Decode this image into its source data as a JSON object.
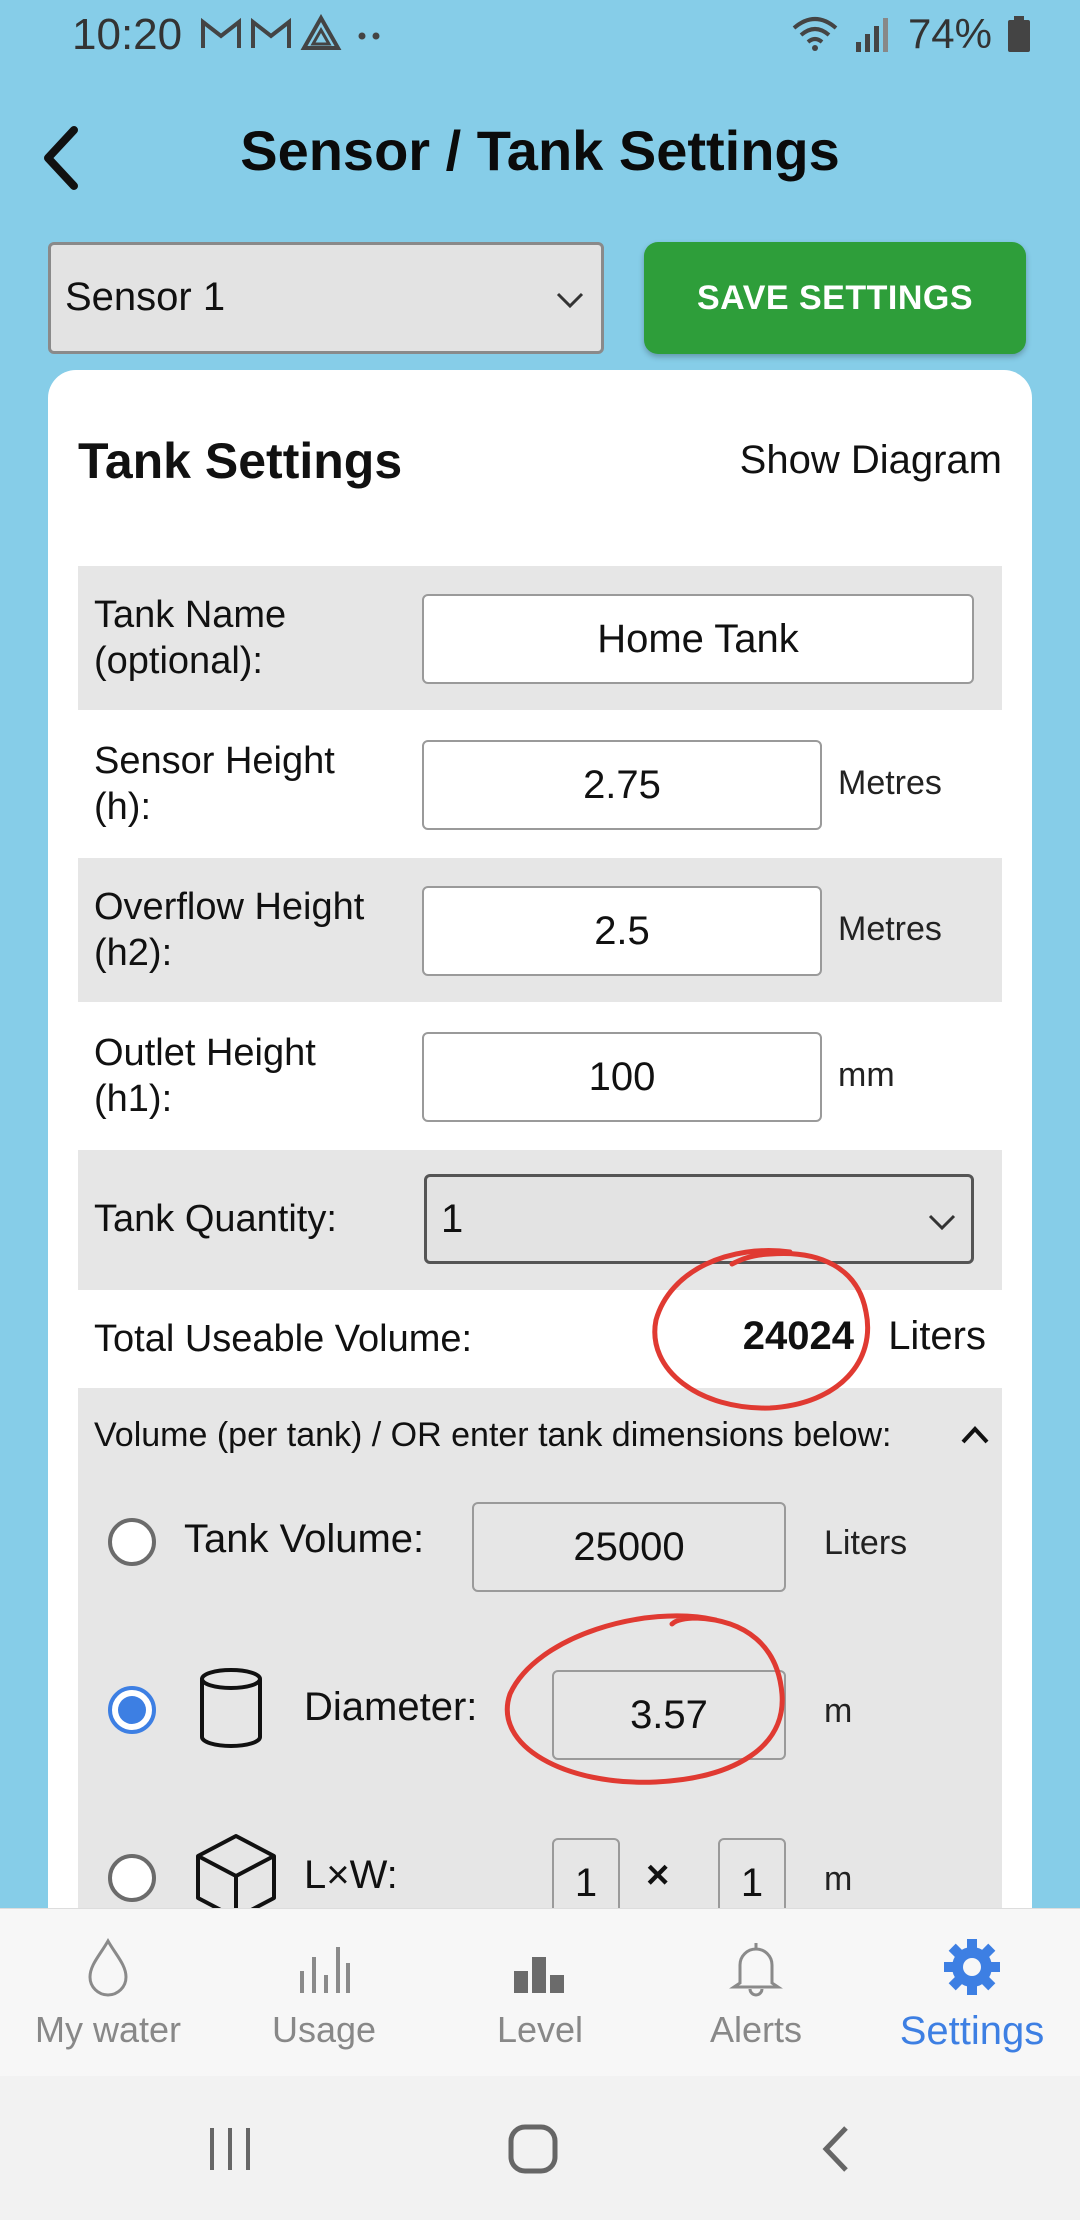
{
  "status_bar": {
    "time": "10:20",
    "battery": "74%"
  },
  "header": {
    "title": "Sensor / Tank Settings"
  },
  "sensor_select": {
    "value": "Sensor 1"
  },
  "save_button": {
    "label": "SAVE SETTINGS"
  },
  "card": {
    "title": "Tank Settings",
    "show_diagram": "Show Diagram",
    "tank_name": {
      "label": "Tank Name (optional):",
      "value": "Home Tank"
    },
    "sensor_height": {
      "label": "Sensor Height (h):",
      "value": "2.75",
      "unit": "Metres"
    },
    "overflow_height": {
      "label": "Overflow Height (h2):",
      "value": "2.5",
      "unit": "Metres"
    },
    "outlet_height": {
      "label": "Outlet Height (h1):",
      "value": "100",
      "unit": "mm"
    },
    "tank_quantity": {
      "label": "Tank Quantity:",
      "value": "1"
    },
    "total_volume": {
      "label": "Total Useable Volume:",
      "value": "24024",
      "unit": "Liters"
    },
    "volume_section": {
      "header": "Volume (per tank) / OR enter tank dimensions below:",
      "tank_volume": {
        "label": "Tank Volume:",
        "value": "25000",
        "unit": "Liters",
        "selected": false
      },
      "diameter": {
        "label": "Diameter:",
        "value": "3.57",
        "unit": "m",
        "selected": true
      },
      "lxw": {
        "label": "L×W:",
        "length": "1",
        "times": "×",
        "width": "1",
        "unit": "m",
        "selected": false
      }
    }
  },
  "bottom_nav": {
    "items": [
      {
        "label": "My water",
        "icon": "water-drop-icon"
      },
      {
        "label": "Usage",
        "icon": "bar-chart-icon"
      },
      {
        "label": "Level",
        "icon": "level-icon"
      },
      {
        "label": "Alerts",
        "icon": "bell-icon"
      },
      {
        "label": "Settings",
        "icon": "gear-icon"
      }
    ],
    "active": "Settings"
  },
  "colors": {
    "background": "#86cde8",
    "save_green": "#2e9e3a",
    "accent_blue": "#3d7fe3",
    "annotation_red": "#e03a32"
  }
}
